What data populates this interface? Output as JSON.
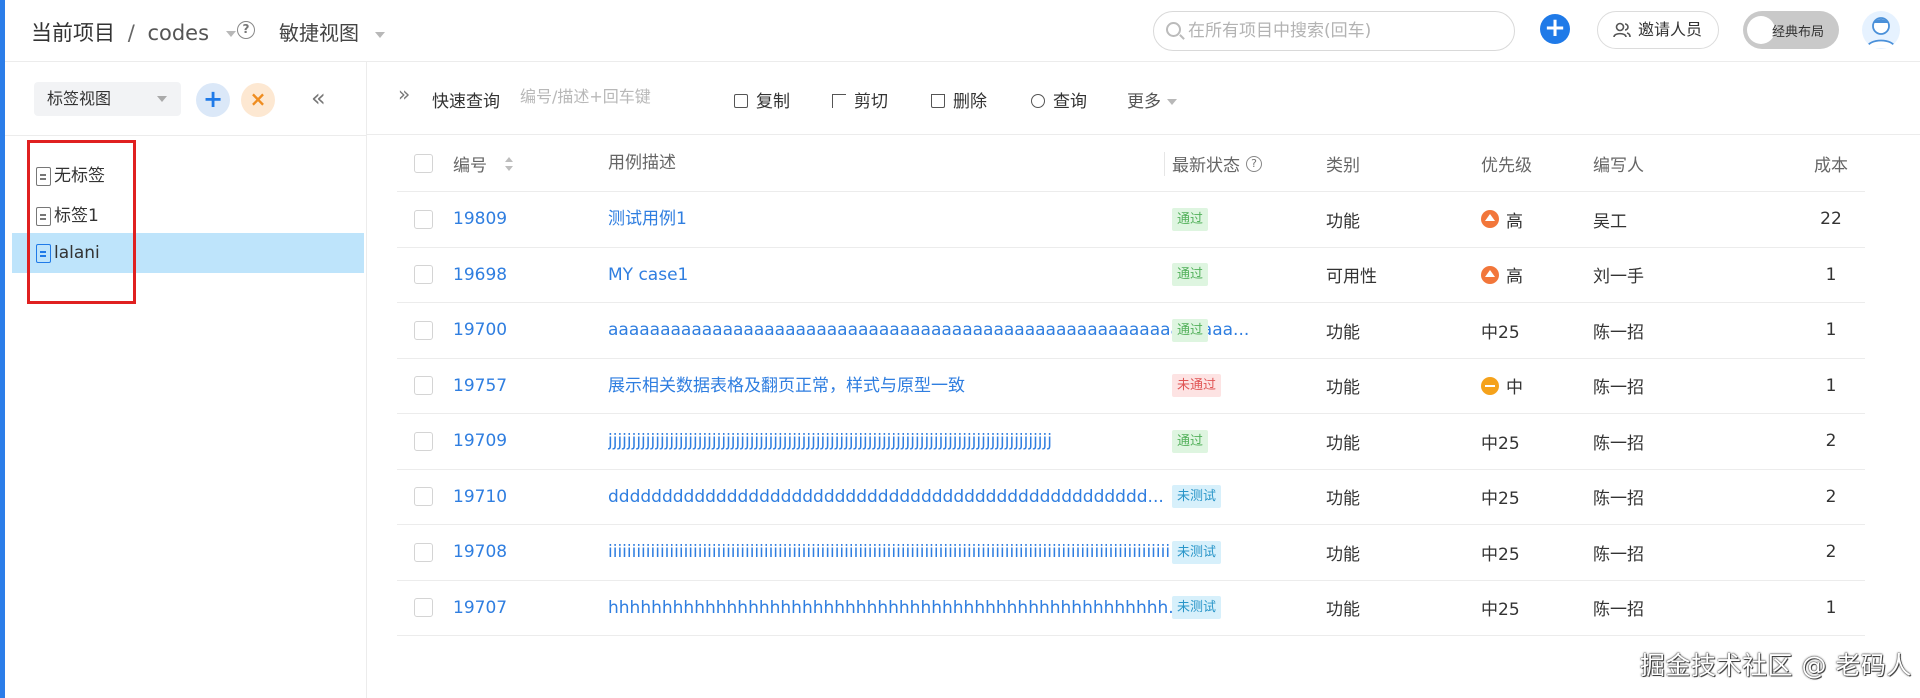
{
  "header": {
    "project_label": "当前项目",
    "project_sep": "/",
    "project_name": "codes",
    "view_name": "敏捷视图",
    "search_placeholder": "在所有项目中搜索(回车)",
    "add_symbol": "+",
    "invite_label": "邀请人员",
    "layout_label": "经典布局",
    "accent_color": "#1f7ae8"
  },
  "sidebar": {
    "view_select": "标签视图",
    "add_symbol": "+",
    "delete_symbol": "×",
    "collapse_symbol": "«",
    "tags": [
      {
        "label": "无标签",
        "active": false
      },
      {
        "label": "标签1",
        "active": false
      },
      {
        "label": "lalani",
        "active": true
      }
    ]
  },
  "toolbar": {
    "expand_symbol": "»",
    "quick_query_label": "快速查询",
    "quick_query_placeholder": "编号/描述+回车键",
    "copy_label": "复制",
    "cut_label": "剪切",
    "delete_label": "删除",
    "query_label": "查询",
    "more_label": "更多"
  },
  "table": {
    "columns": {
      "id": "编号",
      "desc": "用例描述",
      "status": "最新状态",
      "type": "类别",
      "priority": "优先级",
      "author": "编写人",
      "cost": "成本"
    },
    "rows": [
      {
        "id": "19809",
        "desc": "测试用例1",
        "status": "通过",
        "status_kind": "pass",
        "type": "功能",
        "priority": "高",
        "priority_kind": "high",
        "author": "吴工",
        "cost": "22"
      },
      {
        "id": "19698",
        "desc": "MY case1",
        "status": "通过",
        "status_kind": "pass",
        "type": "可用性",
        "priority": "高",
        "priority_kind": "high",
        "author": "刘一手",
        "cost": "1"
      },
      {
        "id": "19700",
        "desc": "aaaaaaaaaaaaaaaaaaaaaaaaaaaaaaaaaaaaaaaaaaaaaaaaaaaaaaaaaaaa...",
        "status": "通过",
        "status_kind": "pass",
        "type": "功能",
        "priority": "中25",
        "priority_kind": "none",
        "author": "陈一招",
        "cost": "1"
      },
      {
        "id": "19757",
        "desc": "展示相关数据表格及翻页正常，样式与原型一致",
        "status": "未通过",
        "status_kind": "fail",
        "type": "功能",
        "priority": "中",
        "priority_kind": "mid",
        "author": "陈一招",
        "cost": "1"
      },
      {
        "id": "19709",
        "desc": "jjjjjjjjjjjjjjjjjjjjjjjjjjjjjjjjjjjjjjjjjjjjjjjjjjjjjjjjjjjjjjjjjjjjjjjjjjjjjjjjjjjjjjjjjjjjjj",
        "status": "通过",
        "status_kind": "pass",
        "type": "功能",
        "priority": "中25",
        "priority_kind": "none",
        "author": "陈一招",
        "cost": "2"
      },
      {
        "id": "19710",
        "desc": "dddddddddddddddddddddddddddddddddddddddddddddddddd...",
        "status": "未测试",
        "status_kind": "untested",
        "type": "功能",
        "priority": "中25",
        "priority_kind": "none",
        "author": "陈一招",
        "cost": "2"
      },
      {
        "id": "19708",
        "desc": "iiiiiiiiiiiiiiiiiiiiiiiiiiiiiiiiiiiiiiiiiiiiiiiiiiiiiiiiiiiiiiiiiiiiiiiiiiiiiiiiiiiiiiiiiiiiiiiiiiiiiiiiiiiiiiiiiiiiiii",
        "status": "未测试",
        "status_kind": "untested",
        "type": "功能",
        "priority": "中25",
        "priority_kind": "none",
        "author": "陈一招",
        "cost": "2"
      },
      {
        "id": "19707",
        "desc": "hhhhhhhhhhhhhhhhhhhhhhhhhhhhhhhhhhhhhhhhhhhhhhhhhhhh...",
        "status": "未测试",
        "status_kind": "untested",
        "type": "功能",
        "priority": "中25",
        "priority_kind": "none",
        "author": "陈一招",
        "cost": "1"
      }
    ]
  },
  "watermark": "掘金技术社区 @ 老码人"
}
